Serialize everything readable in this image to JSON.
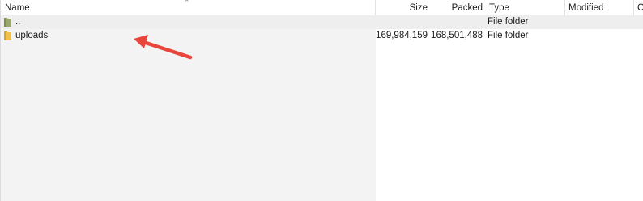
{
  "columns": {
    "name": "Name",
    "size": "Size",
    "packed": "Packed",
    "type": "Type",
    "modified": "Modified",
    "created": "C"
  },
  "sort": {
    "column": "name",
    "indicator_icon": "sort-caret-up-icon"
  },
  "rows": [
    {
      "name": "..",
      "size": "",
      "packed": "",
      "type": "File folder",
      "icon": "parent-folder-icon"
    },
    {
      "name": "uploads",
      "size": "169,984,159",
      "packed": "168,501,488",
      "type": "File folder",
      "icon": "folder-icon"
    }
  ],
  "colors": {
    "annotation_arrow": "#e8453c",
    "folder_yellow": "#f0c24b",
    "parent_folder_green": "#9aa86a",
    "name_column_bg": "#f3f3f3"
  }
}
